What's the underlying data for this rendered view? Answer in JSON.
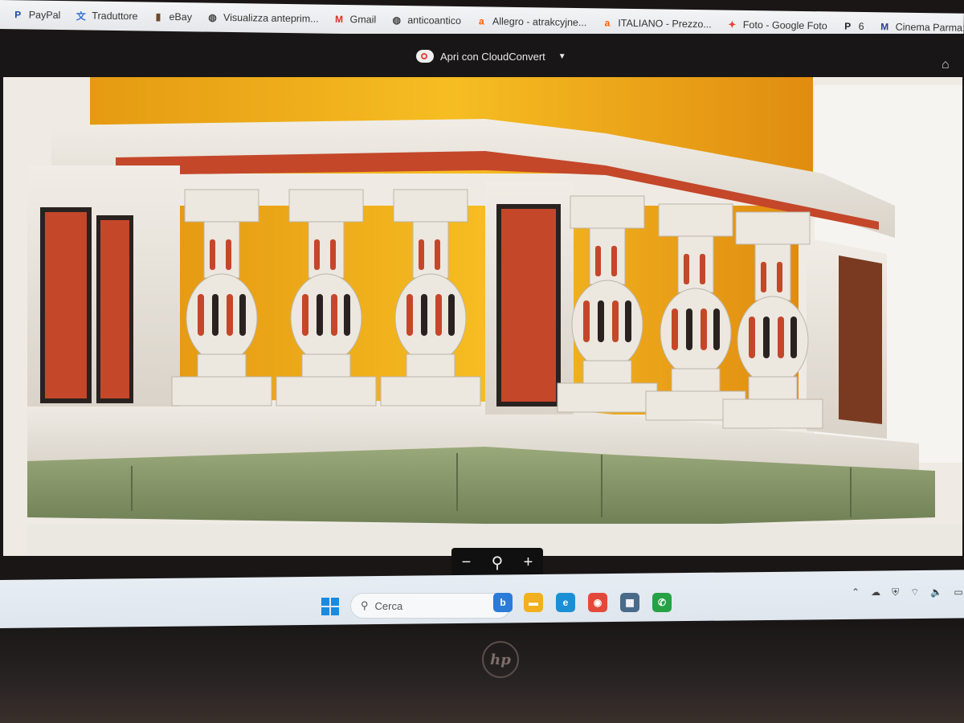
{
  "bookmarks": [
    {
      "label": "PayPal",
      "icon": "paypal-icon",
      "color": "#1d4d9c",
      "glyph": "P"
    },
    {
      "label": "Traduttore",
      "icon": "translate-icon",
      "color": "#2f6fd1",
      "glyph": "文"
    },
    {
      "label": "eBay",
      "icon": "ebay-bag-icon",
      "color": "#6a4a2a",
      "glyph": "▮"
    },
    {
      "label": "Visualizza anteprim...",
      "icon": "globe-icon",
      "color": "#444444",
      "glyph": "◍"
    },
    {
      "label": "Gmail",
      "icon": "gmail-icon",
      "color": "#d93025",
      "glyph": "M"
    },
    {
      "label": "anticoantico",
      "icon": "globe-icon",
      "color": "#444444",
      "glyph": "◍"
    },
    {
      "label": "Allegro - atrakcyjne...",
      "icon": "allegro-icon",
      "color": "#ff5a00",
      "glyph": "a"
    },
    {
      "label": "ITALIANO - Prezzo...",
      "icon": "allegro-icon",
      "color": "#ff5a00",
      "glyph": "a"
    },
    {
      "label": "Foto - Google Foto",
      "icon": "google-photos-icon",
      "color": "#ea4335",
      "glyph": "✦"
    },
    {
      "label": "6",
      "icon": "p-bookmark-icon",
      "color": "#222222",
      "glyph": "P"
    },
    {
      "label": "Cinema Parma: pro...",
      "icon": "cinema-icon",
      "color": "#2d3e8c",
      "glyph": "M"
    }
  ],
  "viewer": {
    "open_with_label": "Apri con CloudConvert",
    "open_with_icon": "cloudconvert-icon",
    "dropdown_icon": "caret-down-icon",
    "add_drive_icon": "add-to-drive-icon"
  },
  "zoom": {
    "zoom_out": "−",
    "zoom_glyph": "⚲",
    "zoom_in": "+"
  },
  "taskbar": {
    "search_placeholder": "Cerca",
    "apps": [
      {
        "icon": "bing-icon",
        "color": "#2b7bd8",
        "glyph": "b"
      },
      {
        "icon": "file-explorer-icon",
        "color": "#f2b01e",
        "glyph": "▬"
      },
      {
        "icon": "edge-icon",
        "color": "#1b8fd6",
        "glyph": "e"
      },
      {
        "icon": "chrome-icon",
        "color": "#e3493a",
        "glyph": "◉"
      },
      {
        "icon": "calculator-icon",
        "color": "#4a6a8a",
        "glyph": "▦"
      },
      {
        "icon": "whatsapp-icon",
        "color": "#25a244",
        "glyph": "✆"
      }
    ],
    "tray_icons": [
      "chevron-up-icon",
      "network-icon",
      "shield-icon",
      "wifi-icon",
      "volume-icon",
      "battery-icon"
    ]
  },
  "bezel": {
    "logo_text": "hp"
  },
  "colors": {
    "marble_white": "#e9e4dc",
    "marble_red": "#c4472a",
    "marble_black": "#2a2220",
    "backdrop_yellow": "#f2b21c",
    "velvet_green": "#8a9a6a"
  }
}
